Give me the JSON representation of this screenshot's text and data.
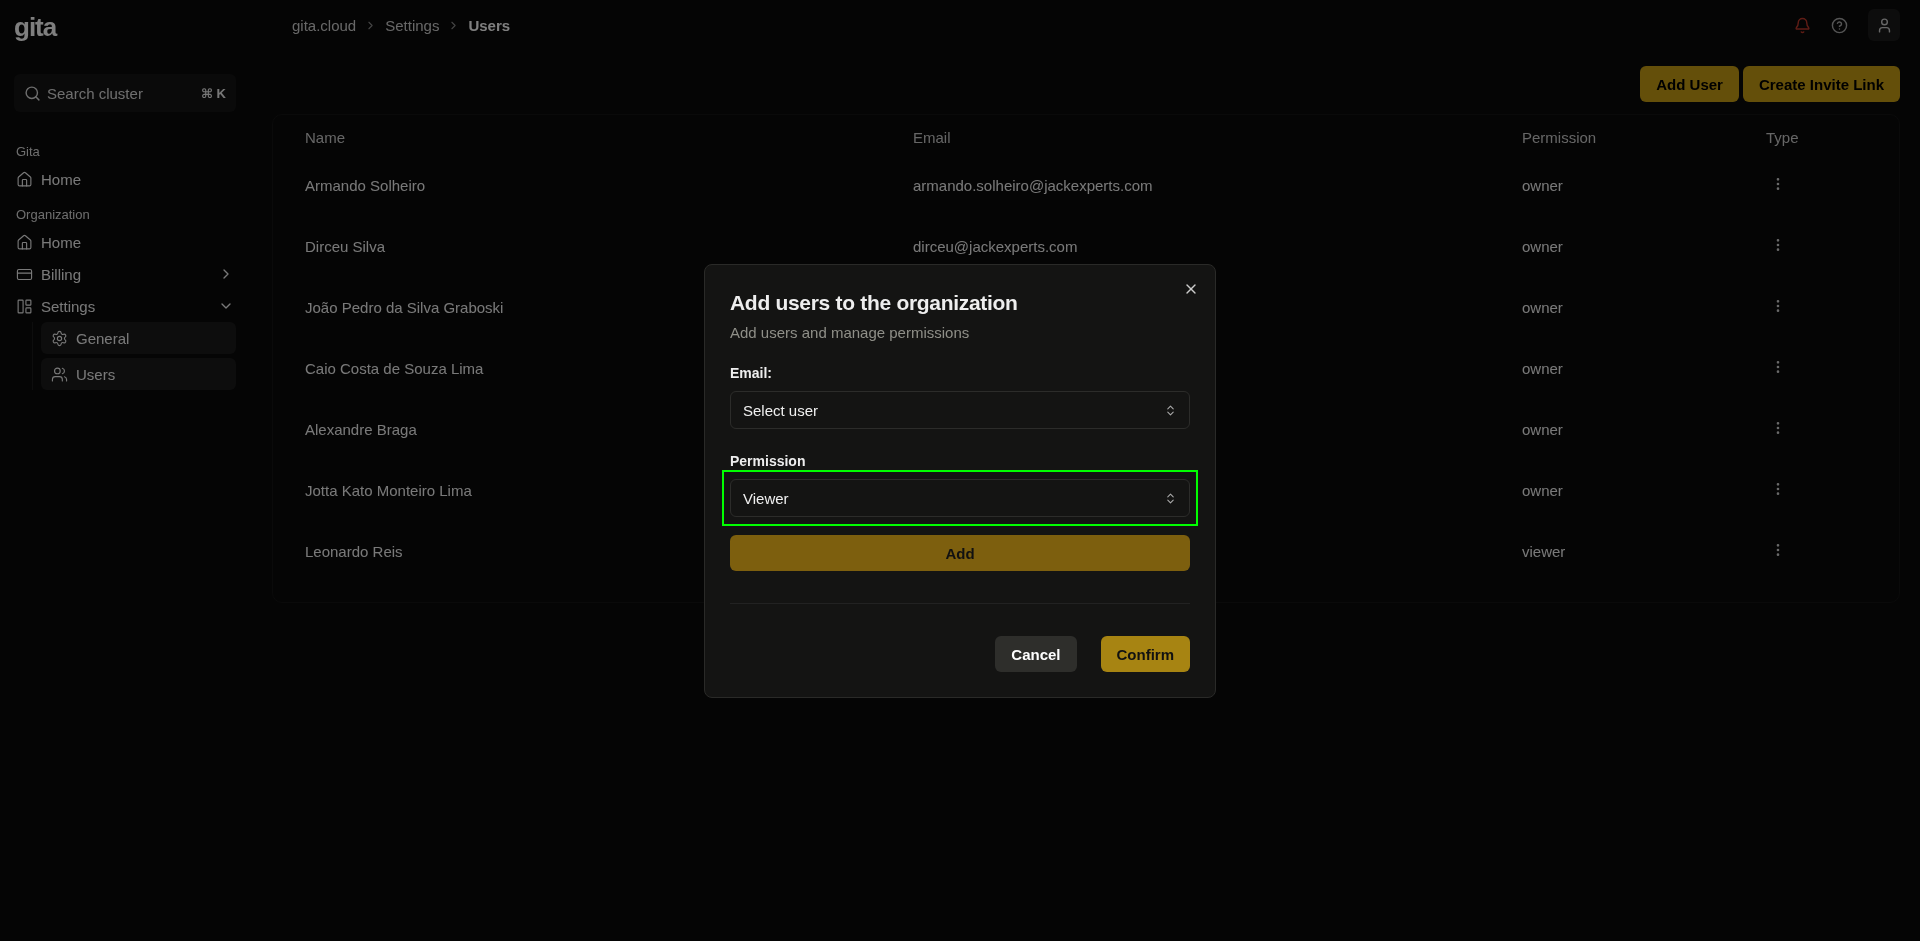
{
  "logo": "gita",
  "search": {
    "placeholder": "Search cluster",
    "shortcut": "⌘ K"
  },
  "breadcrumbs": [
    {
      "label": "gita.cloud",
      "selected": false
    },
    {
      "label": "Settings",
      "selected": false
    },
    {
      "label": "Users",
      "selected": true
    }
  ],
  "sidebar": {
    "groups": [
      {
        "label": "Gita",
        "items": [
          {
            "label": "Home",
            "kind": "home"
          }
        ]
      },
      {
        "label": "Organization",
        "items": [
          {
            "label": "Home",
            "kind": "home"
          },
          {
            "label": "Billing",
            "kind": "billing",
            "expanded": false
          },
          {
            "label": "Settings",
            "kind": "settings",
            "expanded": true,
            "children": [
              {
                "label": "General",
                "kind": "general"
              },
              {
                "label": "Users",
                "kind": "users"
              }
            ]
          }
        ]
      }
    ]
  },
  "actions": [
    "Add User",
    "Create Invite Link"
  ],
  "table": {
    "columns": [
      "Name",
      "Email",
      "Permission",
      "Type"
    ],
    "rows": [
      {
        "name": "Armando Solheiro",
        "email": "armando.solheiro@jackexperts.com",
        "permission": "owner"
      },
      {
        "name": "Dirceu Silva",
        "email": "dirceu@jackexperts.com",
        "permission": "owner"
      },
      {
        "name": "João Pedro da Silva Graboski",
        "permission": "owner"
      },
      {
        "name": "Caio Costa de Souza Lima",
        "permission": "owner"
      },
      {
        "name": "Alexandre Braga",
        "permission": "owner"
      },
      {
        "name": "Jotta Kato Monteiro Lima",
        "permission": "owner"
      },
      {
        "name": "Leonardo Reis",
        "permission": "viewer"
      }
    ]
  },
  "dialog": {
    "title": "Add users to the organization",
    "subtitle": "Add users and manage permissions",
    "fields": [
      {
        "label": "Email:",
        "value": "Select user",
        "highlighted": false
      },
      {
        "label": "Permission",
        "value": "Viewer",
        "highlighted": true
      }
    ],
    "add_button": "Add",
    "buttons": [
      {
        "label": "Cancel",
        "kind": "secondary"
      },
      {
        "label": "Confirm",
        "kind": "primary"
      }
    ]
  }
}
